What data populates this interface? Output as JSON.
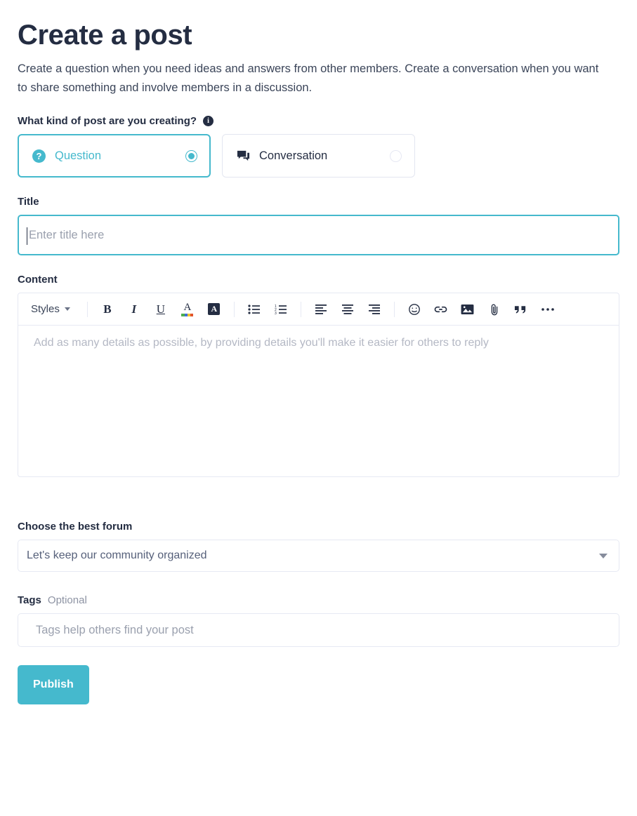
{
  "page": {
    "title": "Create a post",
    "description": "Create a question when you need ideas and answers from other members. Create a conversation when you want to share something and involve members in a discussion."
  },
  "post_type": {
    "label": "What kind of post are you creating?",
    "info_icon": "info-icon",
    "info_glyph": "i",
    "options": [
      {
        "label": "Question",
        "icon": "question-circle-icon",
        "icon_glyph": "?",
        "selected": true
      },
      {
        "label": "Conversation",
        "icon": "comment-bubble-icon",
        "selected": false
      }
    ]
  },
  "title_field": {
    "label": "Title",
    "placeholder": "Enter title here",
    "value": "",
    "focused": true
  },
  "content_field": {
    "label": "Content",
    "placeholder": "Add as many details as possible, by providing details you'll make it easier for others to reply",
    "value": "",
    "toolbar": {
      "styles_label": "Styles",
      "styles_caret": "chevron-down-icon",
      "buttons": [
        {
          "name": "bold-button",
          "glyph": "B"
        },
        {
          "name": "italic-button",
          "glyph": "I"
        },
        {
          "name": "underline-button",
          "glyph": "U"
        },
        {
          "name": "text-color-button",
          "glyph": "A"
        },
        {
          "name": "highlight-color-button",
          "glyph": "A"
        },
        {
          "name": "bulleted-list-button"
        },
        {
          "name": "numbered-list-button"
        },
        {
          "name": "align-left-button"
        },
        {
          "name": "align-center-button"
        },
        {
          "name": "align-right-button"
        },
        {
          "name": "emoji-button"
        },
        {
          "name": "link-button"
        },
        {
          "name": "image-button"
        },
        {
          "name": "attachment-button"
        },
        {
          "name": "blockquote-button"
        },
        {
          "name": "more-options-button"
        }
      ]
    }
  },
  "forum_field": {
    "label": "Choose the best forum",
    "selected_value": "Let's keep our community organized",
    "caret": "chevron-down-icon"
  },
  "tags_field": {
    "label": "Tags",
    "optional_text": "Optional",
    "placeholder": "Tags help others find your post",
    "value": ""
  },
  "actions": {
    "publish_label": "Publish"
  },
  "colors": {
    "accent": "#45b9cd",
    "text": "#242d42",
    "border": "#e6e9f3",
    "placeholder": "#9aa0ae"
  }
}
